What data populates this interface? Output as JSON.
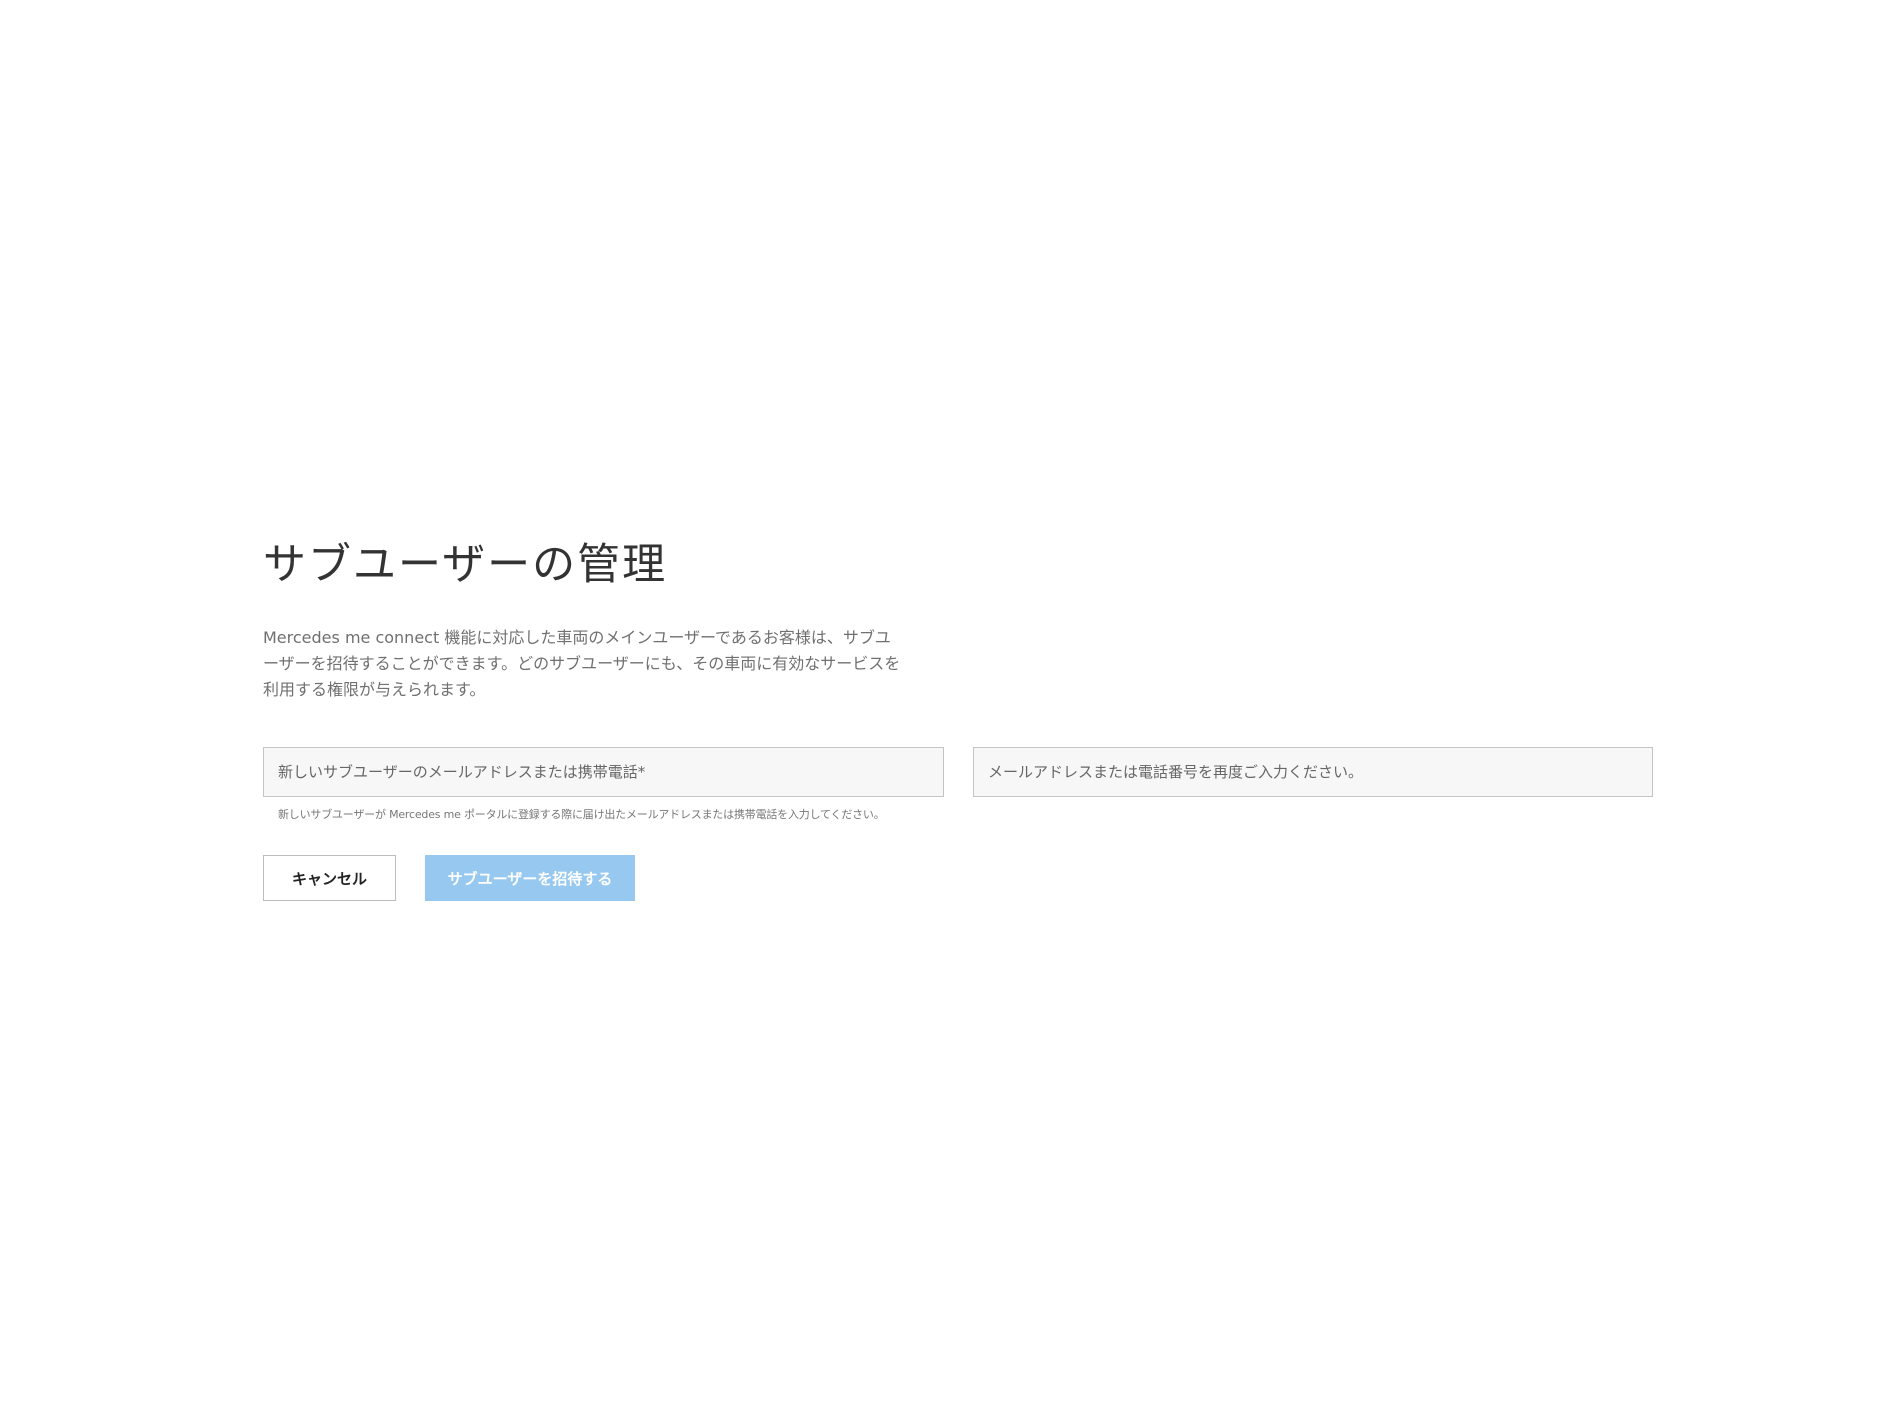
{
  "page": {
    "title": "サブユーザーの管理",
    "description": "Mercedes me connect 機能に対応した車両のメインユーザーであるお客様は、サブユーザーを招待することができます。どのサブユーザーにも、その車両に有効なサービスを利用する権限が与えられます。"
  },
  "form": {
    "email_placeholder": "新しいサブユーザーのメールアドレスまたは携帯電話*",
    "email_value": "",
    "confirm_placeholder": "メールアドレスまたは電話番号を再度ご入力ください。",
    "confirm_value": "",
    "hint": "新しいサブユーザーが Mercedes me ポータルに登録する際に届け出たメールアドレスまたは携帯電話を入力してください。"
  },
  "buttons": {
    "cancel_label": "キャンセル",
    "invite_label": "サブユーザーを招待する"
  },
  "colors": {
    "invite_button_bg": "#97c8ef",
    "field_bg": "#f7f7f7",
    "field_border": "#c4c4c4",
    "title_text": "#333333"
  }
}
